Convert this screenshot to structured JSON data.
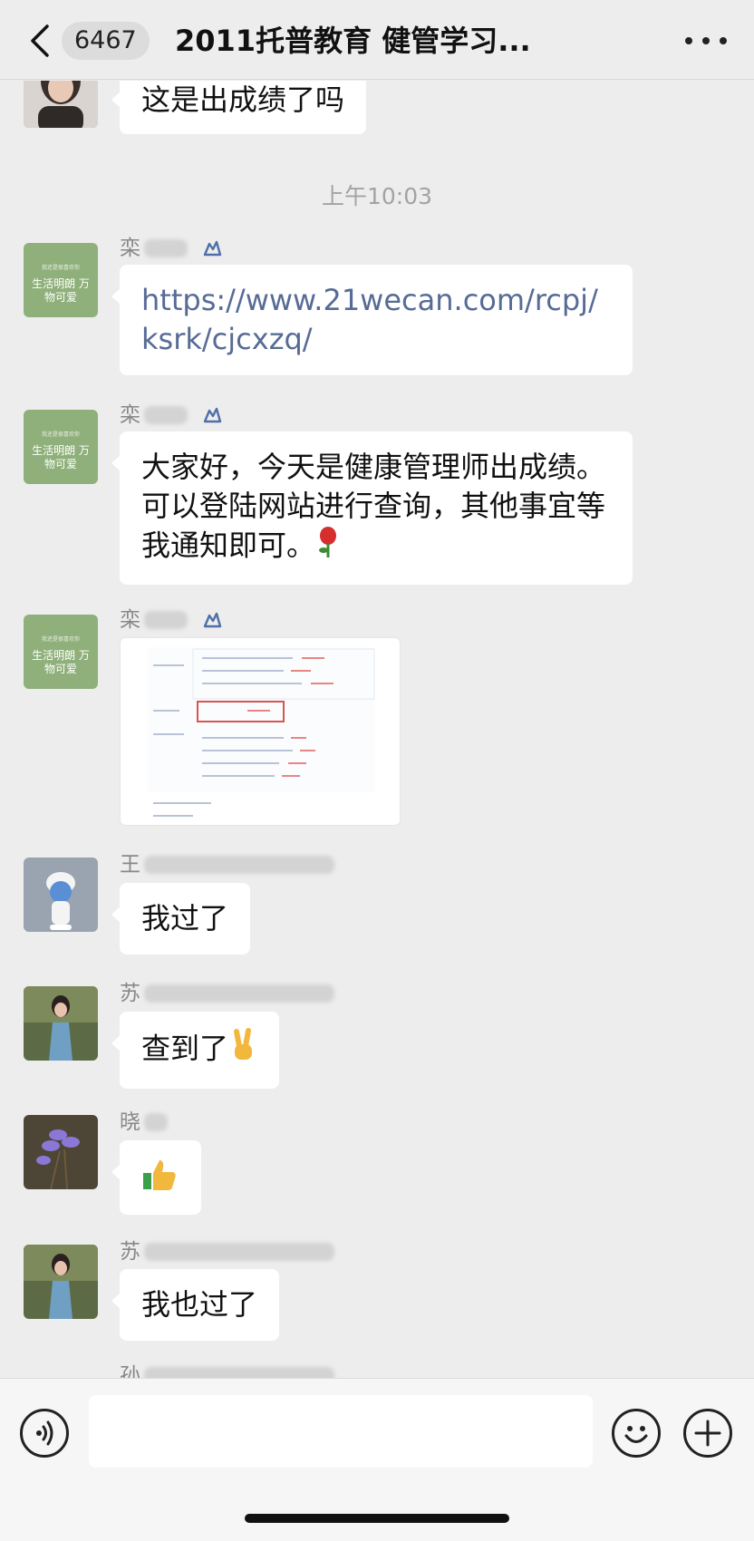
{
  "header": {
    "badge": "6467",
    "title": "2011托普教育 健管学习..."
  },
  "chat": {
    "first_bubble": "这是出成绩了吗",
    "timestamp": "上午10:03",
    "messages": [
      {
        "sender": "栾",
        "text": "https://www.21wecan.com/rcpj/ksrk/cjcxzq/"
      },
      {
        "sender": "栾",
        "text": "大家好，今天是健康管理师出成绩。可以登陆网站进行查询，其他事宜等我通知即可。"
      },
      {
        "sender": "栾"
      },
      {
        "sender": "王",
        "text": "我过了"
      },
      {
        "sender": "苏",
        "text": "查到了"
      },
      {
        "sender": "晓"
      },
      {
        "sender": "苏",
        "text": "我也过了"
      },
      {
        "sender": "孙"
      }
    ],
    "green_avatar_text": "生活明朗 万物可爱",
    "green_avatar_tiny": "我还是很喜欢你"
  },
  "icons": {
    "back": "chevron-left-icon",
    "more": "more-dots-icon",
    "voice": "voice-icon",
    "emoji": "emoji-icon",
    "plus": "plus-icon"
  },
  "colors": {
    "background": "#ededed",
    "bubble": "#ffffff",
    "link": "#576b95",
    "avatar_green": "#8fb07a"
  }
}
